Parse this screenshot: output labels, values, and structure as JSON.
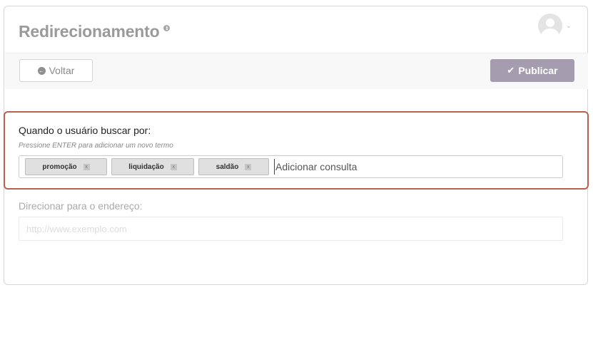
{
  "header": {
    "title": "Redirecionamento",
    "info_icon": "info-icon",
    "user_icon": "avatar-icon",
    "menu_icon": "chevron-down-icon"
  },
  "toolbar": {
    "back_label": "Voltar",
    "back_icon": "circle-arrow-left-icon",
    "publish_label": "Publicar",
    "publish_icon": "check-icon",
    "publish_color": "#a69cb0"
  },
  "search_terms": {
    "label": "Quando o usuário buscar por:",
    "hint": "Pressione ENTER para adicionar um novo termo",
    "tags": [
      "promoção",
      "liquidação",
      "saldão"
    ],
    "remove_label": "x",
    "input_placeholder": "Adicionar consulta",
    "highlight_color": "#b9614a"
  },
  "redirect": {
    "label": "Direcionar para o endereço:",
    "placeholder": "http://www.exemplo.com",
    "value": ""
  }
}
